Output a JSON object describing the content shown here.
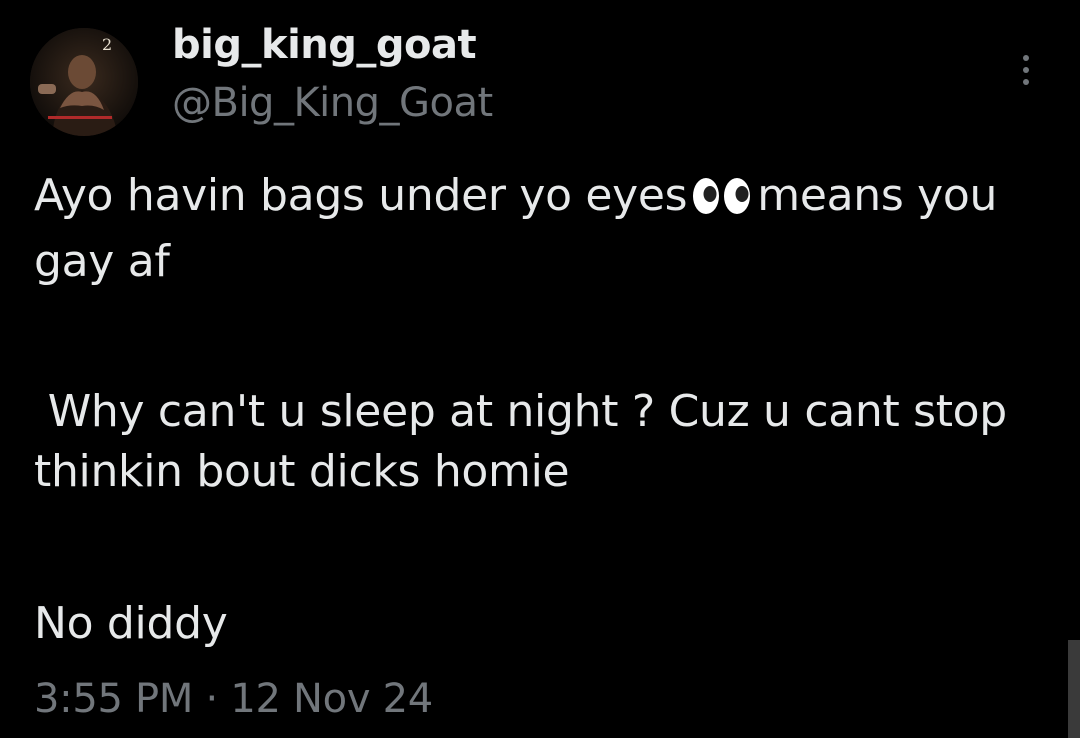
{
  "author": {
    "display_name": "big_king_goat",
    "handle": "@Big_King_Goat",
    "avatar_badge": "2"
  },
  "tweet": {
    "line1_before_emoji": "Ayo havin bags under yo eyes",
    "emoji": "eyes-icon",
    "line1_after_emoji": "means you gay af",
    "paragraph2": " Why can't u sleep at night ? Cuz u cant stop thinkin bout dicks homie",
    "paragraph3": "No diddy"
  },
  "meta": {
    "time": "3:55 PM",
    "separator": "·",
    "date": "12 Nov 24"
  },
  "colors": {
    "background": "#000000",
    "primary_text": "#e7e9ea",
    "secondary_text": "#71767b"
  }
}
